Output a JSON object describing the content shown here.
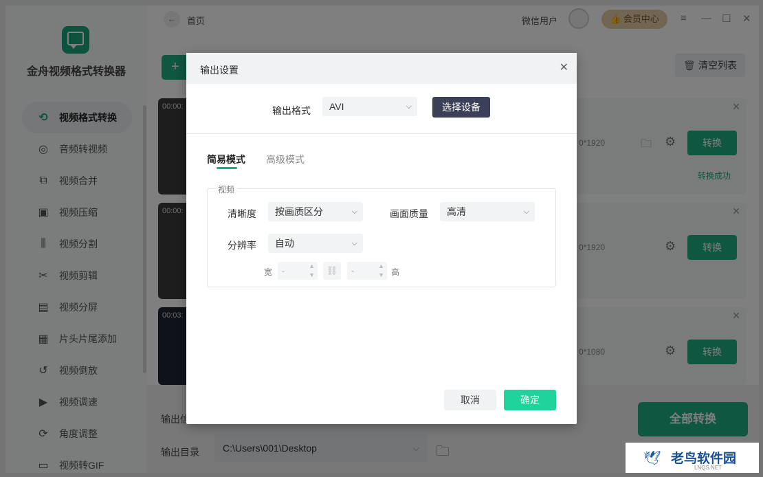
{
  "app": {
    "name": "金舟视频格式转换器"
  },
  "topbar": {
    "back_icon": "arrow-left",
    "breadcrumb": "首页",
    "user": "微信用户",
    "vip": "会员中心"
  },
  "sidebar": {
    "items": [
      {
        "label": "视频格式转换",
        "icon": "⟲"
      },
      {
        "label": "音频转视频",
        "icon": "◎"
      },
      {
        "label": "视频合并",
        "icon": "⧉"
      },
      {
        "label": "视频压缩",
        "icon": "▣"
      },
      {
        "label": "视频分割",
        "icon": "⫼"
      },
      {
        "label": "视频剪辑",
        "icon": "✂"
      },
      {
        "label": "视频分屏",
        "icon": "▤"
      },
      {
        "label": "片头片尾添加",
        "icon": "▦"
      },
      {
        "label": "视频倒放",
        "icon": "↺"
      },
      {
        "label": "视频调速",
        "icon": "▶"
      },
      {
        "label": "角度调整",
        "icon": "⟳"
      },
      {
        "label": "视频转GIF",
        "icon": "▭"
      }
    ]
  },
  "toolbar": {
    "add_label": "+",
    "clear_label": "清空列表"
  },
  "files": [
    {
      "time": "00:00:",
      "resolution": "0*1920",
      "convert": "转换",
      "status": "转换成功"
    },
    {
      "time": "00:00:",
      "resolution": "0*1920",
      "convert": "转换",
      "status": ""
    },
    {
      "time": "00:03:",
      "resolution": "0*1080",
      "convert": "转换",
      "status": ""
    }
  ],
  "footer": {
    "output_label_1": "输出信",
    "output_dir_label": "输出目录",
    "output_dir": "C:\\Users\\001\\Desktop",
    "convert_all": "全部转换"
  },
  "dialog": {
    "title": "输出设置",
    "format_label": "输出格式",
    "format_value": "AVI",
    "device_button": "选择设备",
    "tabs": [
      {
        "label": "简易模式"
      },
      {
        "label": "高级模式"
      }
    ],
    "group_title": "视频",
    "clarity_label": "清晰度",
    "clarity_value": "按画质区分",
    "quality_label": "画面质量",
    "quality_value": "高清",
    "resolution_label": "分辨率",
    "resolution_value": "自动",
    "width_label": "宽",
    "width_value": "-",
    "height_label": "高",
    "height_value": "-",
    "cancel": "取消",
    "confirm": "确定"
  },
  "watermark": {
    "text": "老鸟软件园",
    "sub": "LNQS.NET"
  },
  "colors": {
    "accent": "#1fae80",
    "confirm": "#1fd39b",
    "device": "#3c3f58"
  }
}
